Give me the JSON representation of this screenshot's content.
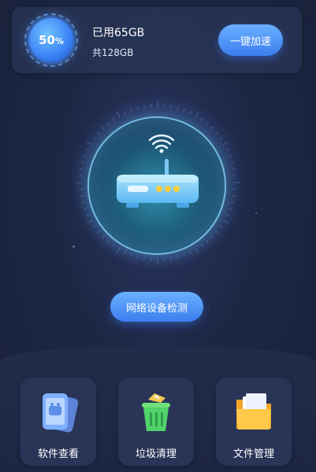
{
  "storage": {
    "percent_label": "50",
    "percent_unit": "%",
    "used_label": "已用65GB",
    "total_label": "共128GB",
    "boost_label": "一键加速"
  },
  "network": {
    "detect_label": "网络设备检测",
    "icon": "router-wifi-icon"
  },
  "tools": [
    {
      "label": "软件查看",
      "icon": "phone-apps-icon"
    },
    {
      "label": "垃圾清理",
      "icon": "trash-bin-icon"
    },
    {
      "label": "文件管理",
      "icon": "folder-icon"
    }
  ],
  "colors": {
    "accent": "#4a8df5",
    "background": "#1d2745",
    "card": "#2a3558"
  }
}
